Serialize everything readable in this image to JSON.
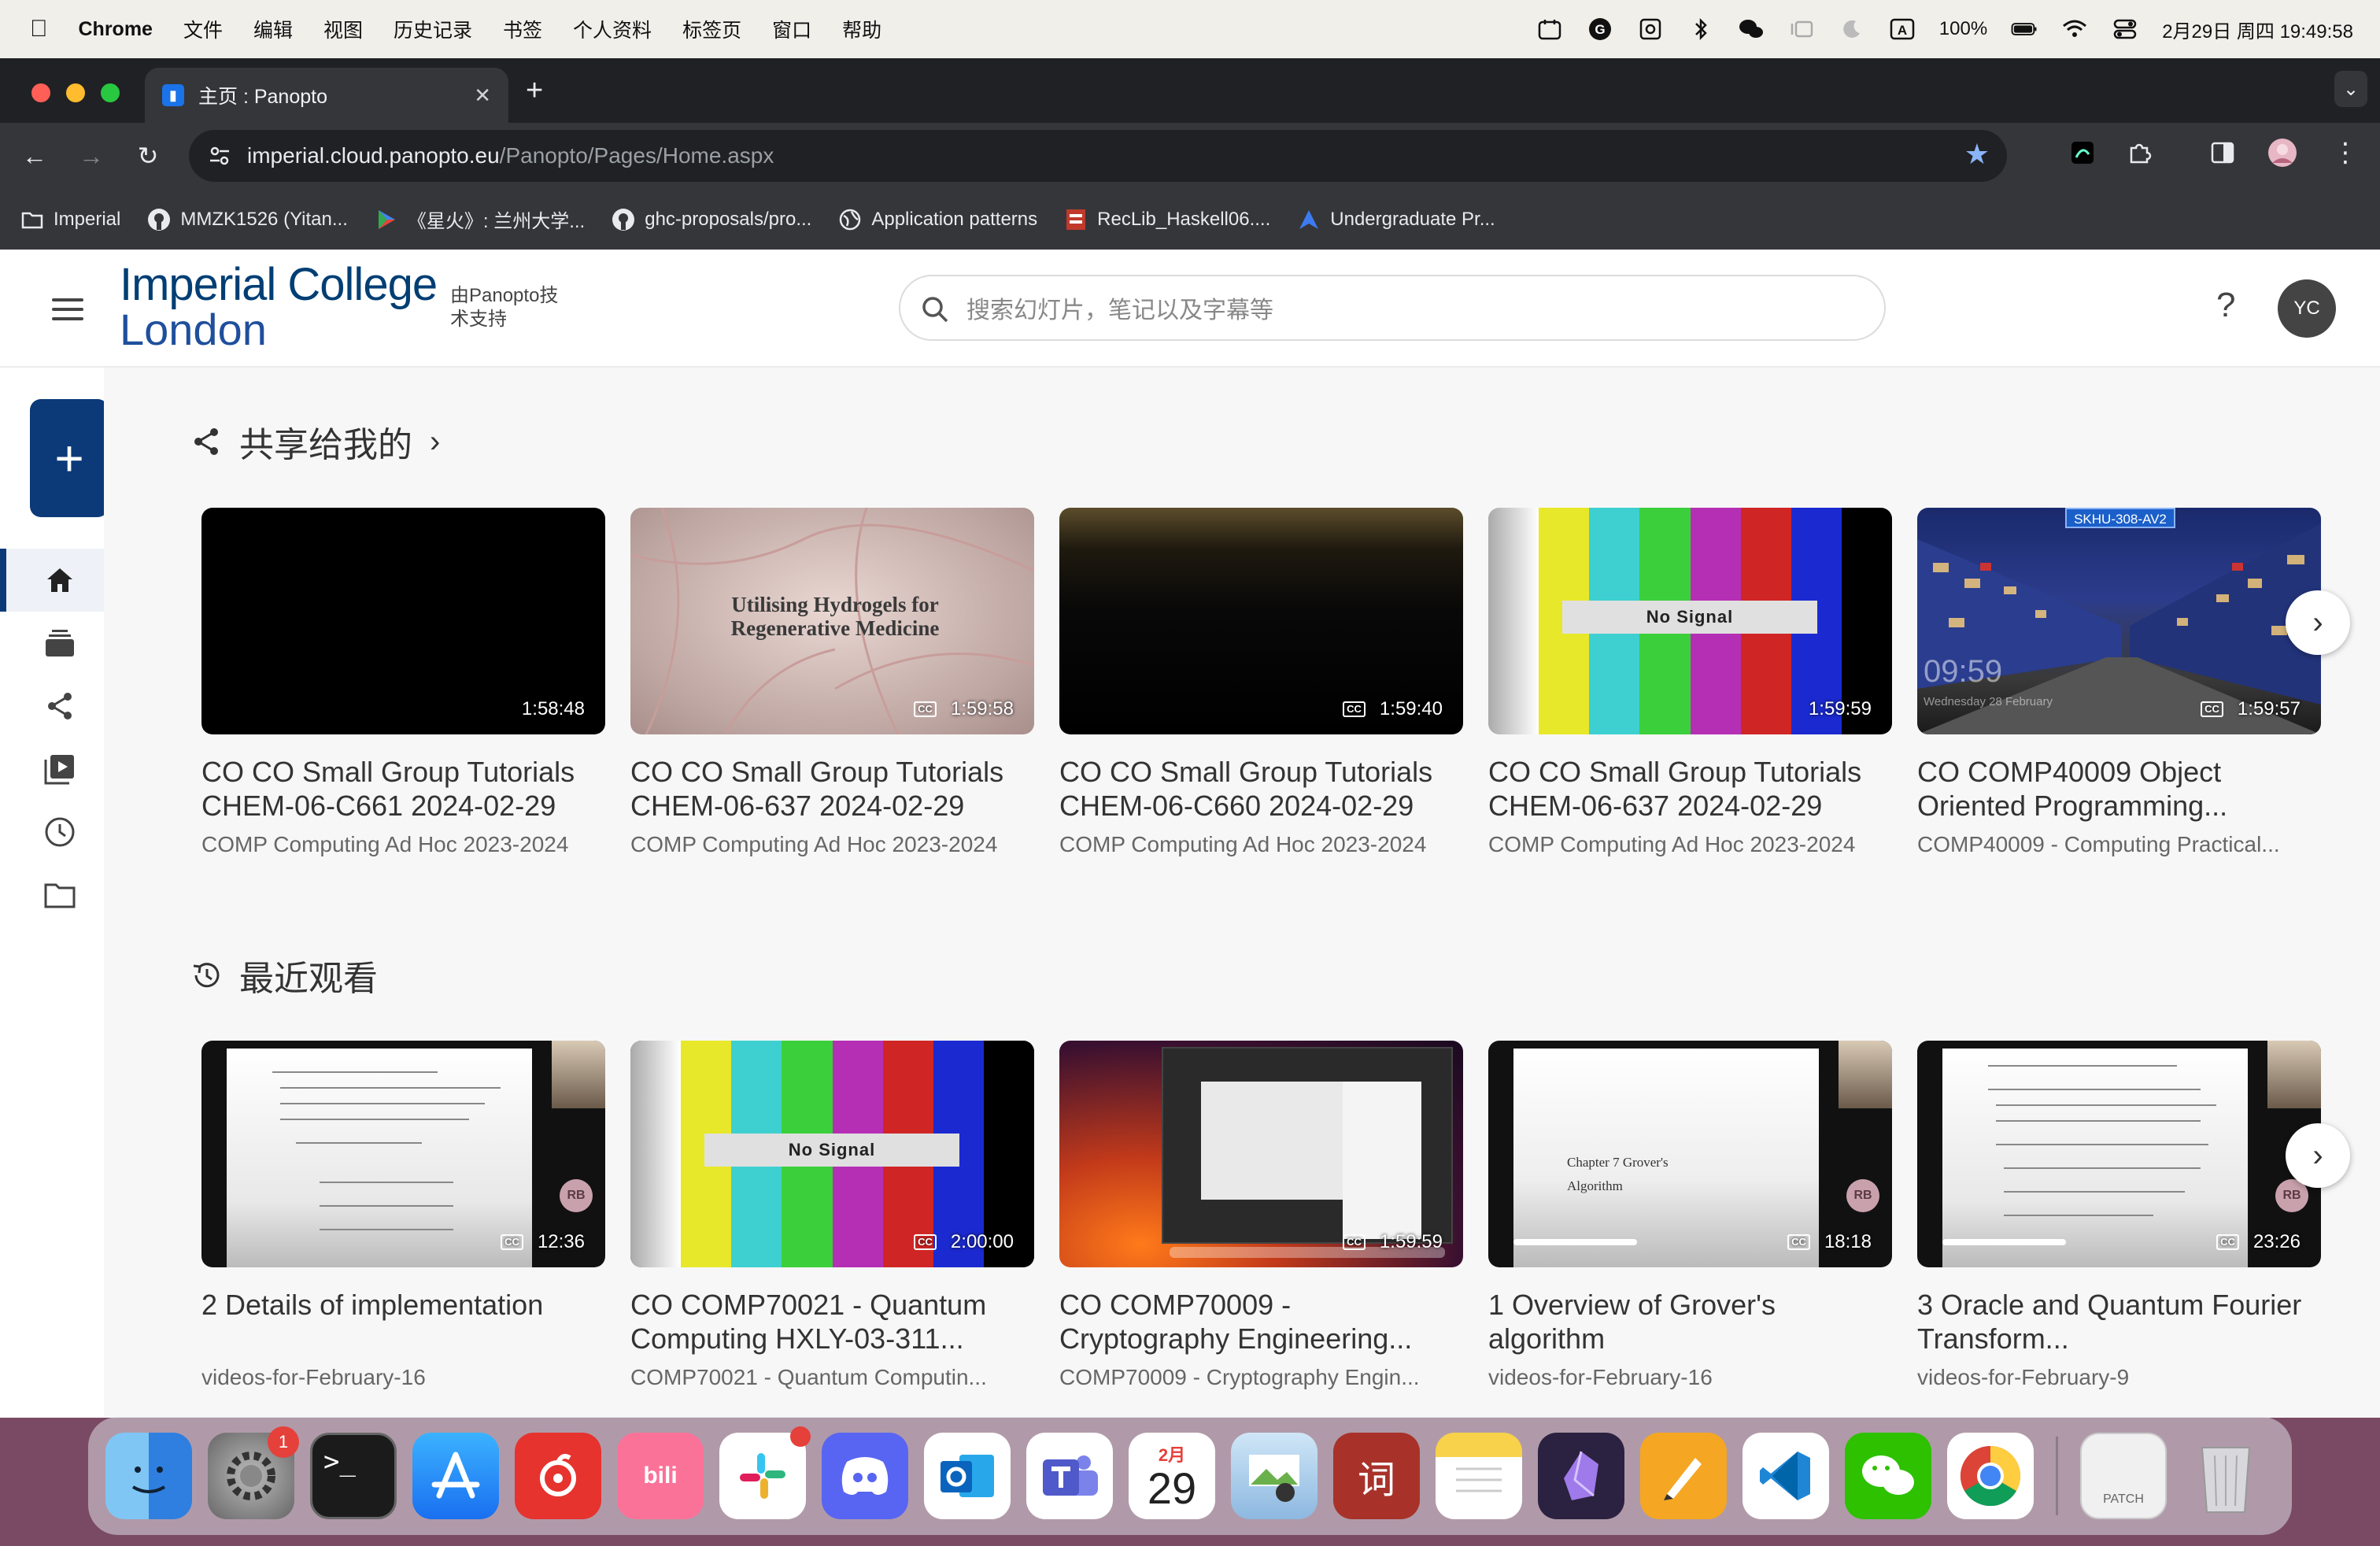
{
  "menubar": {
    "app": "Chrome",
    "items": [
      "文件",
      "编辑",
      "视图",
      "历史记录",
      "书签",
      "个人资料",
      "标签页",
      "窗口",
      "帮助"
    ],
    "battery": "100%",
    "datetime": "2月29日 周四  19:49:58"
  },
  "browser": {
    "tab_title": "主页 : Panopto",
    "url_host": "imperial.cloud.panopto.eu",
    "url_path": "/Panopto/Pages/Home.aspx",
    "bookmarks": [
      {
        "label": "Imperial",
        "icon": "folder-icon"
      },
      {
        "label": "MMZK1526 (Yitan...",
        "icon": "github-icon"
      },
      {
        "label": "《星火》: 兰州大学...",
        "icon": "play-icon"
      },
      {
        "label": "ghc-proposals/pro...",
        "icon": "github-icon"
      },
      {
        "label": "Application patterns",
        "icon": "globe-icon"
      },
      {
        "label": "RecLib_Haskell06....",
        "icon": "doc-icon"
      },
      {
        "label": "Undergraduate Pr...",
        "icon": "arrow-icon"
      }
    ]
  },
  "header": {
    "logo_line1": "Imperial College",
    "logo_line2": "London",
    "powered_by": "由Panopto技术支持",
    "search_placeholder": "搜索幻灯片，笔记以及字幕等",
    "help": "?",
    "avatar": "YC"
  },
  "sections": {
    "shared_title": "共享给我的",
    "recent_title": "最近观看"
  },
  "shared": [
    {
      "title": "CO CO Small Group Tutorials CHEM-06-C661 2024-02-29",
      "subtitle": "COMP Computing Ad Hoc 2023-2024",
      "duration": "1:58:48",
      "cc": false
    },
    {
      "title": "CO CO Small Group Tutorials CHEM-06-637 2024-02-29",
      "subtitle": "COMP Computing Ad Hoc 2023-2024",
      "duration": "1:59:58",
      "cc": true,
      "slide_title": "Utilising Hydrogels for Regenerative Medicine"
    },
    {
      "title": "CO CO Small Group Tutorials CHEM-06-C660 2024-02-29",
      "subtitle": "COMP Computing Ad Hoc 2023-2024",
      "duration": "1:59:40",
      "cc": true
    },
    {
      "title": "CO CO Small Group Tutorials CHEM-06-637 2024-02-29",
      "subtitle": "COMP Computing Ad Hoc 2023-2024",
      "duration": "1:59:59",
      "cc": false,
      "overlay": "No Signal"
    },
    {
      "title": "CO COMP40009 Object Oriented Programming...",
      "subtitle": "COMP40009 - Computing Practical...",
      "duration": "1:59:57",
      "cc": true,
      "overlay": "SKHU-308-AV2",
      "clock": "09:59",
      "date": "Wednesday 28 February"
    }
  ],
  "recent": [
    {
      "title": "2 Details of implementation",
      "subtitle": "videos-for-February-16",
      "duration": "12:36",
      "cc": true,
      "initials": "RB"
    },
    {
      "title": "CO COMP70021 - Quantum Computing HXLY-03-311...",
      "subtitle": "COMP70021 - Quantum Computin...",
      "duration": "2:00:00",
      "cc": true,
      "overlay": "No Signal"
    },
    {
      "title": "CO COMP70009 - Cryptography Engineering...",
      "subtitle": "COMP70009 - Cryptography Engin...",
      "duration": "1:59:59",
      "cc": true
    },
    {
      "title": "1 Overview of Grover's algorithm",
      "subtitle": "videos-for-February-16",
      "duration": "18:18",
      "cc": true,
      "initials": "RB",
      "progress": 0.35,
      "slide_title": "Chapter 7 Grover's Algorithm"
    },
    {
      "title": "3 Oracle and Quantum Fourier Transform...",
      "subtitle": "videos-for-February-9",
      "duration": "23:26",
      "cc": true,
      "initials": "RB",
      "progress": 0.35
    }
  ],
  "dock": {
    "calendar_month": "2月",
    "calendar_day": "29",
    "settings_badge": "1",
    "dict_label": "词",
    "patch_label": "PATCH"
  },
  "colors": {
    "brand": "#0c3a78",
    "accent": "#1a73e8"
  }
}
